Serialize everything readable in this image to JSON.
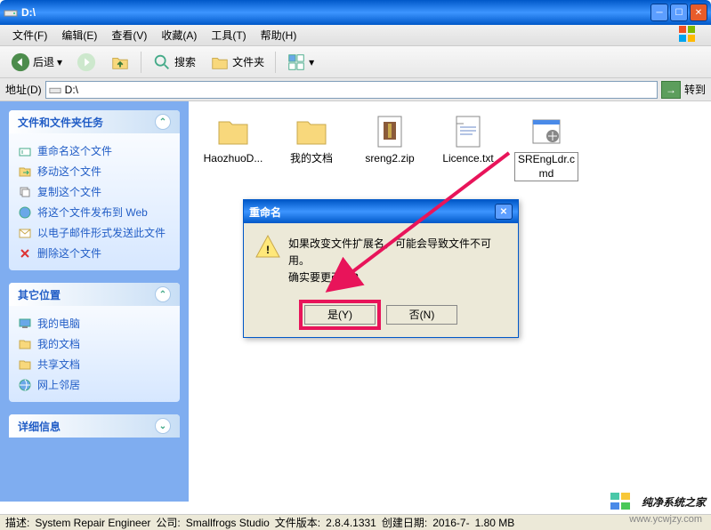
{
  "window": {
    "title": "D:\\"
  },
  "menubar": {
    "file": "文件(F)",
    "edit": "编辑(E)",
    "view": "查看(V)",
    "favorites": "收藏(A)",
    "tools": "工具(T)",
    "help": "帮助(H)"
  },
  "toolbar": {
    "back": "后退",
    "search": "搜索",
    "folders": "文件夹"
  },
  "addressbar": {
    "label": "地址(D)",
    "path": "D:\\",
    "go": "转到"
  },
  "sidebar": {
    "panel1": {
      "title": "文件和文件夹任务",
      "items": [
        "重命名这个文件",
        "移动这个文件",
        "复制这个文件",
        "将这个文件发布到 Web",
        "以电子邮件形式发送此文件",
        "删除这个文件"
      ]
    },
    "panel2": {
      "title": "其它位置",
      "items": [
        "我的电脑",
        "我的文档",
        "共享文档",
        "网上邻居"
      ]
    },
    "panel3": {
      "title": "详细信息"
    }
  },
  "files": [
    {
      "name": "HaozhuoD...",
      "type": "folder"
    },
    {
      "name": "我的文档",
      "type": "folder"
    },
    {
      "name": "sreng2.zip",
      "type": "zip"
    },
    {
      "name": "Licence.txt",
      "type": "txt"
    },
    {
      "name": "SREngLdr.cmd",
      "type": "cmd",
      "selected": true
    }
  ],
  "dialog": {
    "title": "重命名",
    "line1": "如果改变文件扩展名，可能会导致文件不可用。",
    "line2": "确实要更改吗?",
    "yes": "是(Y)",
    "no": "否(N)"
  },
  "statusbar": {
    "desc_label": "描述:",
    "desc": "System Repair Engineer",
    "company_label": "公司:",
    "company": "Smallfrogs Studio",
    "ver_label": "文件版本:",
    "ver": "2.8.4.1331",
    "date_label": "创建日期:",
    "date": "2016-7-",
    "size": "1.80 MB"
  },
  "watermark": {
    "text": "纯净系统之家",
    "url": "www.ycwjzy.com"
  }
}
